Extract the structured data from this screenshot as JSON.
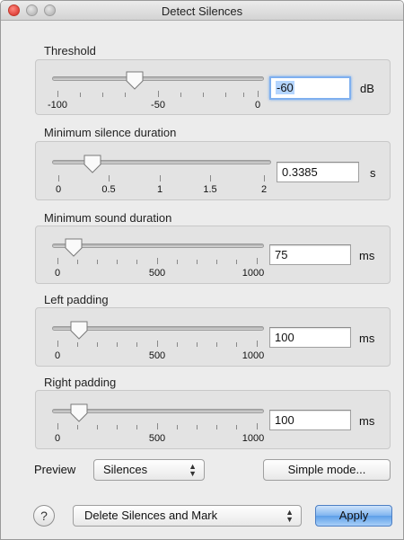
{
  "window": {
    "title": "Detect Silences"
  },
  "threshold": {
    "label": "Threshold",
    "value": "-60",
    "unit": "dB",
    "ticks": [
      "-100",
      "-50",
      "0"
    ]
  },
  "min_silence": {
    "label": "Minimum silence duration",
    "value": "0.3385",
    "unit": "s",
    "ticks": [
      "0",
      "0.5",
      "1",
      "1.5",
      "2"
    ]
  },
  "min_sound": {
    "label": "Minimum sound duration",
    "value": "75",
    "unit": "ms",
    "ticks": [
      "0",
      "500",
      "1000"
    ]
  },
  "left_padding": {
    "label": "Left padding",
    "value": "100",
    "unit": "ms",
    "ticks": [
      "0",
      "500",
      "1000"
    ]
  },
  "right_padding": {
    "label": "Right padding",
    "value": "100",
    "unit": "ms",
    "ticks": [
      "0",
      "500",
      "1000"
    ]
  },
  "preview": {
    "label": "Preview",
    "selected": "Silences",
    "simple_mode": "Simple mode..."
  },
  "footer": {
    "help": "?",
    "action_selected": "Delete Silences and Mark",
    "apply": "Apply"
  },
  "icons": {
    "close": "close-icon",
    "minimize": "minimize-icon",
    "zoom": "zoom-icon",
    "popup": "updown-arrows-icon"
  }
}
